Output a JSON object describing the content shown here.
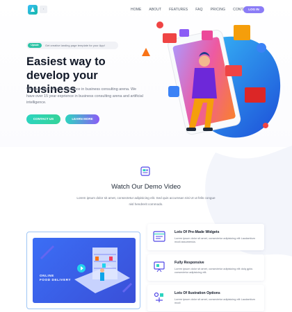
{
  "header": {
    "logo_icon": "logo-icon",
    "nav": [
      "HOME",
      "ABOUT",
      "FEATURES",
      "FAQ",
      "PRICING",
      "CONTACT"
    ],
    "login_label": "LOG IN",
    "accent": "#8b7cf6"
  },
  "hero": {
    "badge_label": "Upsale",
    "badge_text": "Get creative landing page template for your App!",
    "title": "Easiest way to develop your business",
    "description": "We have over 15 year exprience in business consulting arena. We have over 15 year exprience in business consulting arena and artificial intelligence.",
    "contact_label": "CONTACT US",
    "learn_label": "LEARN MORE"
  },
  "demo": {
    "icon": "video-icon",
    "title": "Watch Our Demo Video",
    "description": "Lorem ipsum dolor sit amet, consectetur adipisicing elit. Sed quis accumsan nisi Ut ut felis congue nisl hendrerit commodo.",
    "video_line1": "ONLINE",
    "video_line2": "FOOD DELIVERY"
  },
  "features": [
    {
      "icon": "browser-window-icon",
      "title": "Lots Of Pre-Made Widgets",
      "text": "Lorem ipsum dolor sit amet, consectetur adipisicing elit Laudantium modi assumenda."
    },
    {
      "icon": "presentation-icon",
      "title": "Fully Responsive",
      "text": "Lorem ipsum dolor sit amet, consectetur adipisicing elit dolq gpks consectetur adipisicing elit."
    },
    {
      "icon": "illustration-options-icon",
      "title": "Lots Of Ilustration Options",
      "text": "Lorem ipsum dolor sit amet, consectetur adipisicing elit Laudantium modi"
    }
  ]
}
